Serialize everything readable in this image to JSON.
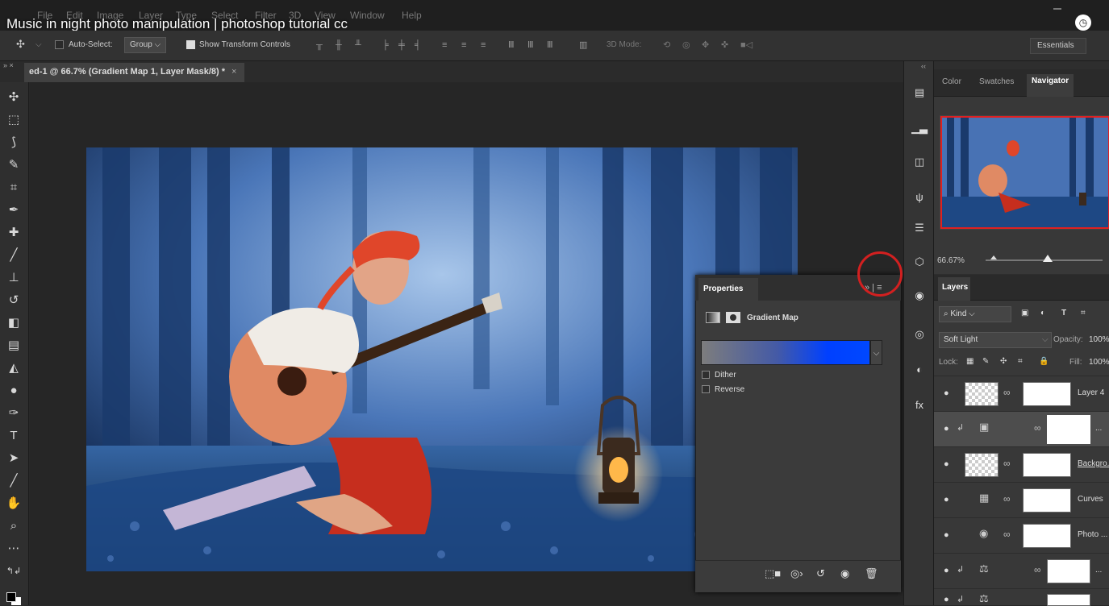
{
  "video": {
    "title": "Music in night photo manipulation | photoshop tutorial cc"
  },
  "menu": [
    "File",
    "Edit",
    "Image",
    "Layer",
    "Type",
    "Select",
    "Filter",
    "3D",
    "View",
    "Window",
    "Help"
  ],
  "options": {
    "auto_select_label": "Auto-Select:",
    "auto_select_value": "Group",
    "show_transform_label": "Show Transform Controls",
    "mode_3d_label": "3D Mode:",
    "workspace": "Essentials"
  },
  "document": {
    "tab_title": "ed-1 @ 66.7% (Gradient Map 1, Layer Mask/8) *",
    "close": "×"
  },
  "tabbar_arrows": "» ×",
  "dock_arrows": "‹‹",
  "right_tabs": {
    "color": "Color",
    "swatches": "Swatches",
    "navigator": "Navigator"
  },
  "navigator": {
    "zoom": "66.67%"
  },
  "layers": {
    "tab": "Layers",
    "filter_kind": "Kind",
    "blend_mode": "Soft Light",
    "opacity_label": "Opacity:",
    "opacity_value": "100%",
    "lock_label": "Lock:",
    "fill_label": "Fill:",
    "fill_value": "100%",
    "items": [
      {
        "name": "Layer 4"
      },
      {
        "name": "..."
      },
      {
        "name": "Backgro..."
      },
      {
        "name": "Curves"
      },
      {
        "name": "Photo ..."
      },
      {
        "name": "..."
      },
      {
        "name": ""
      }
    ]
  },
  "properties": {
    "tab": "Properties",
    "type_label": "Gradient Map",
    "dither_label": "Dither",
    "reverse_label": "Reverse",
    "collapse": "»",
    "menu": "≡"
  },
  "colors": {
    "accent_red": "#d22020",
    "gradient_start": "#7d7d7d",
    "gradient_end": "#0048ff"
  }
}
